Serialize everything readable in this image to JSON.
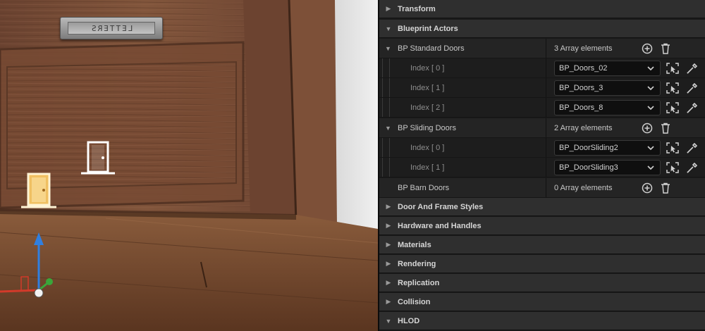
{
  "viewport": {
    "plaque_text": "LETTERS",
    "door_icons": [
      "door-icon",
      "door-icon"
    ]
  },
  "details": {
    "categories_top": [
      {
        "label": "Transform",
        "expanded": false
      },
      {
        "label": "Blueprint Actors",
        "expanded": true
      }
    ],
    "groups": [
      {
        "name": "BP Standard Doors",
        "count_label": "3 Array elements",
        "expanded": true,
        "elements": [
          {
            "index": "Index [ 0 ]",
            "value": "BP_Doors_02"
          },
          {
            "index": "Index [ 1 ]",
            "value": "BP_Doors_3"
          },
          {
            "index": "Index [ 2 ]",
            "value": "BP_Doors_8"
          }
        ]
      },
      {
        "name": "BP Sliding Doors",
        "count_label": "2 Array elements",
        "expanded": true,
        "elements": [
          {
            "index": "Index [ 0 ]",
            "value": "BP_DoorSliding2"
          },
          {
            "index": "Index [ 1 ]",
            "value": "BP_DoorSliding3"
          }
        ]
      },
      {
        "name": "BP Barn Doors",
        "count_label": "0 Array elements",
        "expanded": false,
        "elements": []
      }
    ],
    "categories_bottom": [
      {
        "label": "Door And Frame Styles",
        "expanded": false
      },
      {
        "label": "Hardware and Handles",
        "expanded": false
      },
      {
        "label": "Materials",
        "expanded": false
      },
      {
        "label": "Rendering",
        "expanded": false
      },
      {
        "label": "Replication",
        "expanded": false
      },
      {
        "label": "Collision",
        "expanded": false
      },
      {
        "label": "HLOD",
        "expanded": true
      }
    ]
  },
  "colors": {
    "panel_bg": "#1a1a1a",
    "category_bg": "#2f2f2f",
    "combo_bg": "#0f0f0f",
    "wood": "#7a4f36",
    "gizmo_z": "#2f7fe0",
    "gizmo_x": "#d23a2a",
    "gizmo_y": "#3aa63a"
  }
}
